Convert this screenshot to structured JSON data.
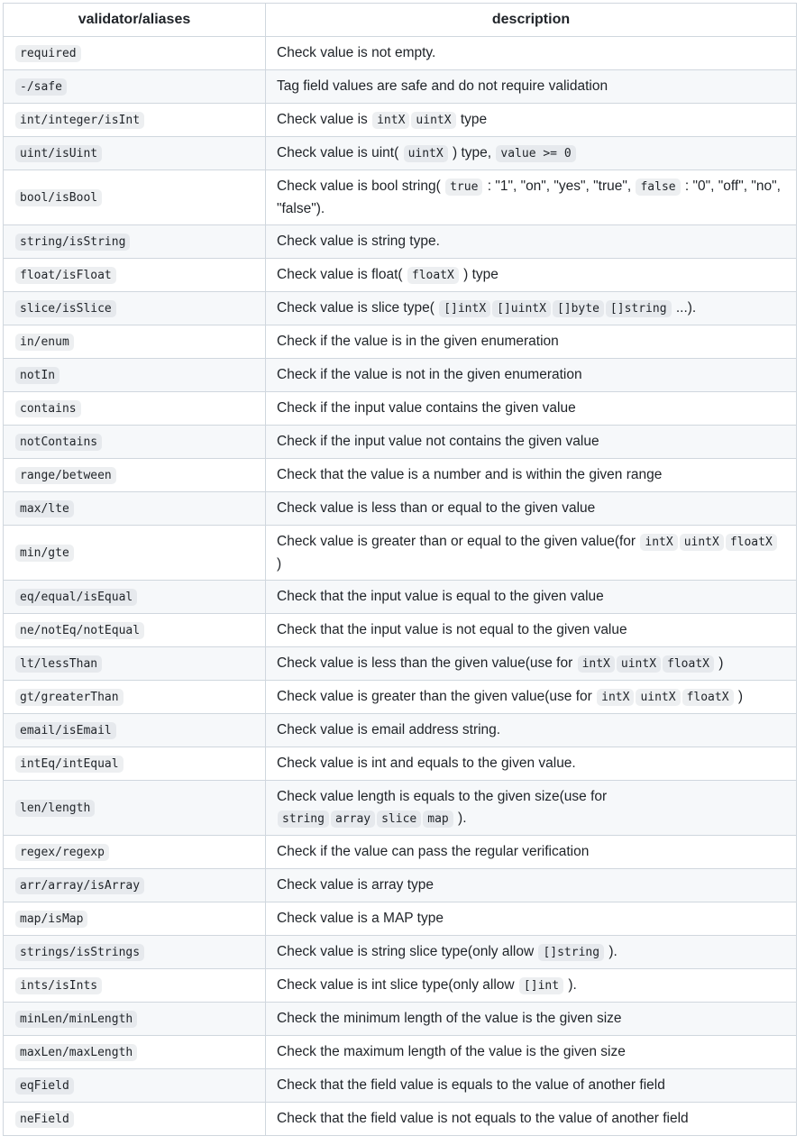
{
  "headers": {
    "validator": "validator/aliases",
    "description": "description"
  },
  "rows": [
    {
      "validator": "required",
      "desc": [
        {
          "t": "Check value is not empty."
        }
      ]
    },
    {
      "validator": "-/safe",
      "desc": [
        {
          "t": "Tag field values are safe and do not require validation"
        }
      ]
    },
    {
      "validator": "int/integer/isInt",
      "desc": [
        {
          "t": "Check value is "
        },
        {
          "c": "intX"
        },
        {
          "c": "uintX"
        },
        {
          "t": " type"
        }
      ]
    },
    {
      "validator": "uint/isUint",
      "desc": [
        {
          "t": "Check value is uint( "
        },
        {
          "c": "uintX"
        },
        {
          "t": " ) type, "
        },
        {
          "c": "value >= 0"
        }
      ]
    },
    {
      "validator": "bool/isBool",
      "tall": true,
      "desc": [
        {
          "t": "Check value is bool string( "
        },
        {
          "c": "true"
        },
        {
          "t": " : \"1\", \"on\", \"yes\", \"true\", "
        },
        {
          "c": "false"
        },
        {
          "t": " : \"0\", \"off\", \"no\", \"false\")."
        }
      ]
    },
    {
      "validator": "string/isString",
      "desc": [
        {
          "t": "Check value is string type."
        }
      ]
    },
    {
      "validator": "float/isFloat",
      "desc": [
        {
          "t": "Check value is float( "
        },
        {
          "c": "floatX"
        },
        {
          "t": " ) type"
        }
      ]
    },
    {
      "validator": "slice/isSlice",
      "desc": [
        {
          "t": "Check value is slice type( "
        },
        {
          "c": "[]intX"
        },
        {
          "c": "[]uintX"
        },
        {
          "c": "[]byte"
        },
        {
          "c": "[]string"
        },
        {
          "t": " ...)."
        }
      ]
    },
    {
      "validator": "in/enum",
      "desc": [
        {
          "t": "Check if the value is in the given enumeration"
        }
      ]
    },
    {
      "validator": "notIn",
      "desc": [
        {
          "t": "Check if the value is not in the given enumeration"
        }
      ]
    },
    {
      "validator": "contains",
      "desc": [
        {
          "t": "Check if the input value contains the given value"
        }
      ]
    },
    {
      "validator": "notContains",
      "desc": [
        {
          "t": "Check if the input value not contains the given value"
        }
      ]
    },
    {
      "validator": "range/between",
      "desc": [
        {
          "t": "Check that the value is a number and is within the given range"
        }
      ]
    },
    {
      "validator": "max/lte",
      "desc": [
        {
          "t": "Check value is less than or equal to the given value"
        }
      ]
    },
    {
      "validator": "min/gte",
      "tall": true,
      "desc": [
        {
          "t": "Check value is greater than or equal to the given value(for "
        },
        {
          "c": "intX"
        },
        {
          "c": "uintX"
        },
        {
          "c": "floatX"
        },
        {
          "t": " )"
        }
      ]
    },
    {
      "validator": "eq/equal/isEqual",
      "desc": [
        {
          "t": "Check that the input value is equal to the given value"
        }
      ]
    },
    {
      "validator": "ne/notEq/notEqual",
      "desc": [
        {
          "t": "Check that the input value is not equal to the given value"
        }
      ]
    },
    {
      "validator": "lt/lessThan",
      "desc": [
        {
          "t": "Check value is less than the given value(use for "
        },
        {
          "c": "intX"
        },
        {
          "c": "uintX"
        },
        {
          "c": "floatX"
        },
        {
          "t": " )"
        }
      ]
    },
    {
      "validator": "gt/greaterThan",
      "desc": [
        {
          "t": "Check value is greater than the given value(use for "
        },
        {
          "c": "intX"
        },
        {
          "c": "uintX"
        },
        {
          "c": "floatX"
        },
        {
          "t": " )"
        }
      ]
    },
    {
      "validator": "email/isEmail",
      "desc": [
        {
          "t": "Check value is email address string."
        }
      ]
    },
    {
      "validator": "intEq/intEqual",
      "desc": [
        {
          "t": "Check value is int and equals to the given value."
        }
      ]
    },
    {
      "validator": "len/length",
      "tall": true,
      "desc": [
        {
          "t": "Check value length is equals to the given size(use for "
        },
        {
          "c": "string"
        },
        {
          "c": "array"
        },
        {
          "c": "slice"
        },
        {
          "c": "map"
        },
        {
          "t": " )."
        }
      ]
    },
    {
      "validator": "regex/regexp",
      "desc": [
        {
          "t": "Check if the value can pass the regular verification"
        }
      ]
    },
    {
      "validator": "arr/array/isArray",
      "desc": [
        {
          "t": "Check value is array type"
        }
      ]
    },
    {
      "validator": "map/isMap",
      "desc": [
        {
          "t": "Check value is a MAP type"
        }
      ]
    },
    {
      "validator": "strings/isStrings",
      "desc": [
        {
          "t": "Check value is string slice type(only allow "
        },
        {
          "c": "[]string"
        },
        {
          "t": " )."
        }
      ]
    },
    {
      "validator": "ints/isInts",
      "desc": [
        {
          "t": "Check value is int slice type(only allow "
        },
        {
          "c": "[]int"
        },
        {
          "t": " )."
        }
      ]
    },
    {
      "validator": "minLen/minLength",
      "desc": [
        {
          "t": "Check the minimum length of the value is the given size"
        }
      ]
    },
    {
      "validator": "maxLen/maxLength",
      "desc": [
        {
          "t": "Check the maximum length of the value is the given size"
        }
      ]
    },
    {
      "validator": "eqField",
      "desc": [
        {
          "t": "Check that the field value is equals to the value of another field"
        }
      ]
    },
    {
      "validator": "neField",
      "desc": [
        {
          "t": "Check that the field value is not equals to the value of another field"
        }
      ]
    }
  ]
}
